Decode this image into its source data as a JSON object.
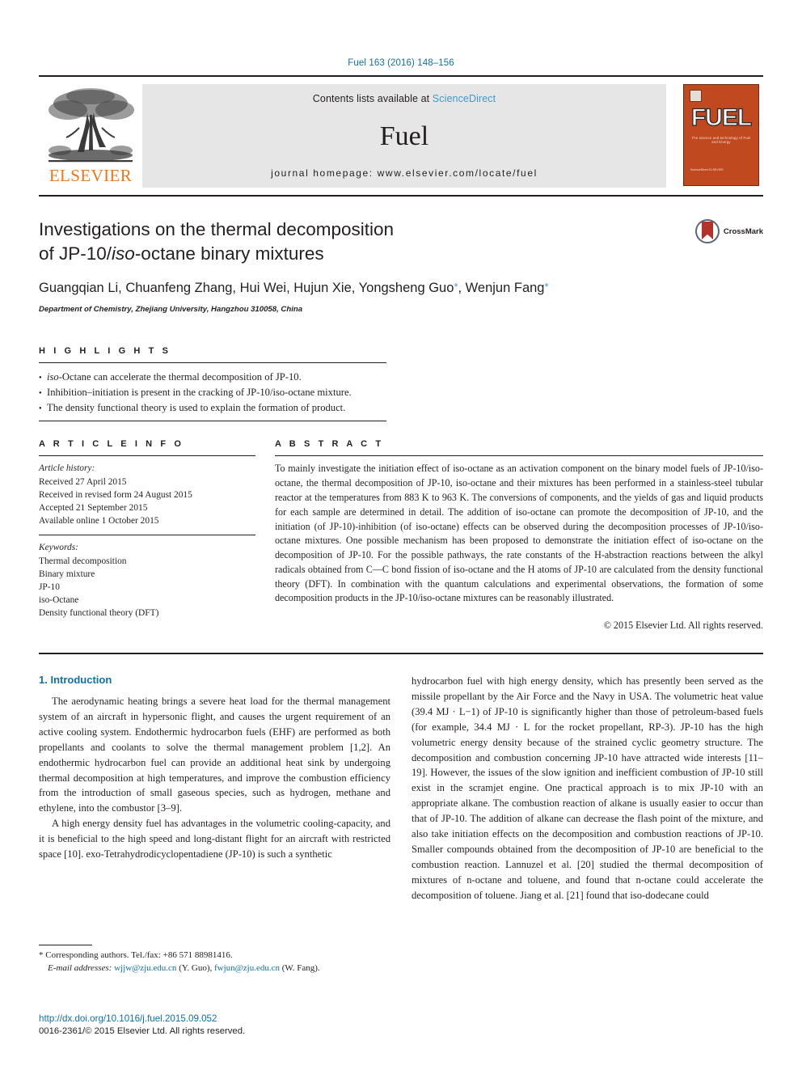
{
  "running_head": "Fuel 163 (2016) 148–156",
  "masthead": {
    "publisher_name": "ELSEVIER",
    "contents_prefix": "Contents lists available at ",
    "contents_link": "ScienceDirect",
    "journal_name": "Fuel",
    "homepage": "journal homepage: www.elsevier.com/locate/fuel",
    "cover": {
      "wordmark": "FUEL",
      "tagline": "The science and technology of Fuel and Energy",
      "bottom_text": "ScienceDirect ELSEVIER"
    }
  },
  "article": {
    "title_line1": "Investigations on the thermal decomposition",
    "title_line2_pre": "of JP-10/",
    "title_line2_italic": "iso",
    "title_line2_post": "-octane binary mixtures",
    "authors": "Guangqian Li, Chuanfeng Zhang, Hui Wei, Hujun Xie, Yongsheng Guo",
    "authors_tail": ", Wenjun Fang",
    "affiliation": "Department of Chemistry, Zhejiang University, Hangzhou 310058, China",
    "crossmark_label": "CrossMark"
  },
  "highlights": {
    "heading": "H I G H L I G H T S",
    "items": [
      {
        "italic_lead": "iso",
        "rest": "-Octane can accelerate the thermal decomposition of JP-10."
      },
      {
        "italic_lead": "",
        "rest": "Inhibition–initiation is present in the cracking of JP-10/iso-octane mixture."
      },
      {
        "italic_lead": "",
        "rest": "The density functional theory is used to explain the formation of product."
      }
    ]
  },
  "article_info": {
    "heading": "A R T I C L E   I N F O",
    "history_label": "Article history:",
    "history": [
      "Received 27 April 2015",
      "Received in revised form 24 August 2015",
      "Accepted 21 September 2015",
      "Available online 1 October 2015"
    ],
    "keywords_label": "Keywords:",
    "keywords": [
      "Thermal decomposition",
      "Binary mixture",
      "JP-10",
      "iso-Octane",
      "Density functional theory (DFT)"
    ]
  },
  "abstract": {
    "heading": "A B S T R A C T",
    "text": "To mainly investigate the initiation effect of iso-octane as an activation component on the binary model fuels of JP-10/iso-octane, the thermal decomposition of JP-10, iso-octane and their mixtures has been performed in a stainless-steel tubular reactor at the temperatures from 883 K to 963 K. The conversions of components, and the yields of gas and liquid products for each sample are determined in detail. The addition of iso-octane can promote the decomposition of JP-10, and the initiation (of JP-10)-inhibition (of iso-octane) effects can be observed during the decomposition processes of JP-10/iso-octane mixtures. One possible mechanism has been proposed to demonstrate the initiation effect of iso-octane on the decomposition of JP-10. For the possible pathways, the rate constants of the H-abstraction reactions between the alkyl radicals obtained from C—C bond fission of iso-octane and the H atoms of JP-10 are calculated from the density functional theory (DFT). In combination with the quantum calculations and experimental observations, the formation of some decomposition products in the JP-10/iso-octane mixtures can be reasonably illustrated.",
    "copyright": "© 2015 Elsevier Ltd. All rights reserved."
  },
  "introduction": {
    "section_title": "1. Introduction",
    "left_paragraphs": [
      "The aerodynamic heating brings a severe heat load for the thermal management system of an aircraft in hypersonic flight, and causes the urgent requirement of an active cooling system. Endothermic hydrocarbon fuels (EHF) are performed as both propellants and coolants to solve the thermal management problem [1,2]. An endothermic hydrocarbon fuel can provide an additional heat sink by undergoing thermal decomposition at high temperatures, and improve the combustion efficiency from the introduction of small gaseous species, such as hydrogen, methane and ethylene, into the combustor [3–9].",
      "A high energy density fuel has advantages in the volumetric cooling-capacity, and it is beneficial to the high speed and long-distant flight for an aircraft with restricted space [10]. exo-Tetrahydrodicyclopentadiene (JP-10) is such a synthetic"
    ],
    "right_paragraphs": [
      "hydrocarbon fuel with high energy density, which has presently been served as the missile propellant by the Air Force and the Navy in USA. The volumetric heat value (39.4 MJ · L−1) of JP-10 is significantly higher than those of petroleum-based fuels (for example, 34.4 MJ · L for the rocket propellant, RP-3). JP-10 has the high volumetric energy density because of the strained cyclic geometry structure. The decomposition and combustion concerning JP-10 have attracted wide interests [11–19]. However, the issues of the slow ignition and inefficient combustion of JP-10 still exist in the scramjet engine. One practical approach is to mix JP-10 with an appropriate alkane. The combustion reaction of alkane is usually easier to occur than that of JP-10. The addition of alkane can decrease the flash point of the mixture, and also take initiation effects on the decomposition and combustion reactions of JP-10. Smaller compounds obtained from the decomposition of JP-10 are beneficial to the combustion reaction. Lannuzel et al. [20] studied the thermal decomposition of mixtures of n-octane and toluene, and found that n-octane could accelerate the decomposition of toluene. Jiang et al. [21] found that iso-dodecane could"
    ]
  },
  "footnotes": {
    "corresponding": "* Corresponding authors. Tel./fax: +86 571 88981416.",
    "email_label": "E-mail addresses:",
    "email1": "wjjw@zju.edu.cn",
    "email1_owner": " (Y. Guo), ",
    "email2": "fwjun@zju.edu.cn",
    "email2_owner": " (W. Fang)."
  },
  "footer": {
    "doi": "http://dx.doi.org/10.1016/j.fuel.2015.09.052",
    "issn": "0016-2361/© 2015 Elsevier Ltd. All rights reserved."
  },
  "colors": {
    "link_blue": "#1070a8",
    "sciencedirect_blue": "#3a9bd9",
    "elsevier_orange": "#e87722",
    "cover_orange": "#c0491f",
    "band_gray": "#e6e6e6"
  }
}
